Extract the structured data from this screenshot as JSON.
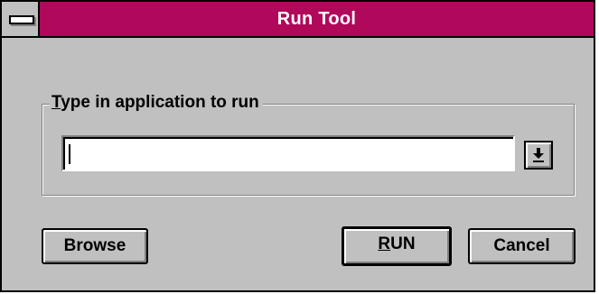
{
  "window": {
    "title": "Run Tool"
  },
  "group": {
    "label_mnemonic": "T",
    "label_rest": "ype in application to run"
  },
  "combo": {
    "value": "",
    "placeholder": ""
  },
  "buttons": {
    "browse": "Browse",
    "run_mnemonic": "R",
    "run_rest": "UN",
    "cancel": "Cancel"
  },
  "colors": {
    "titlebar": "#b0085a",
    "face": "#c0c0c0"
  },
  "icons": {
    "system_menu": "system-menu-icon",
    "dropdown": "dropdown-arrow-icon"
  }
}
